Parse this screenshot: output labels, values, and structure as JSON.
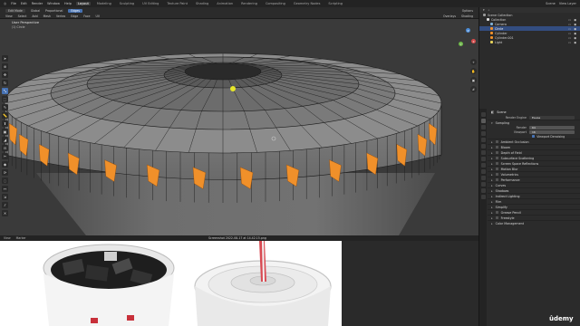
{
  "menubar": {
    "menus": [
      "File",
      "Edit",
      "Render",
      "Window",
      "Help"
    ],
    "workspaces": [
      "Layout",
      "Modeling",
      "Sculpting",
      "UV Editing",
      "Texture Paint",
      "Shading",
      "Animation",
      "Rendering",
      "Compositing",
      "Geometry Nodes",
      "Scripting"
    ],
    "active_workspace": "Layout",
    "right": [
      "Scene",
      "View Layer"
    ]
  },
  "toolheader": {
    "mode": "Edit Mode",
    "items": [
      "Global",
      "Proportional",
      "Options"
    ],
    "select_mode": "Edges"
  },
  "viewheader": {
    "items": [
      "View",
      "Select",
      "Add",
      "Mesh",
      "Vertex",
      "Edge",
      "Face",
      "UV"
    ],
    "shading": "Shading",
    "overlays": "Overlays"
  },
  "viewport": {
    "title": "User Perspective",
    "subtitle": "(1) Circle"
  },
  "toolbar": {
    "tools": [
      "select-tool",
      "cursor-tool",
      "move-tool",
      "rotate-tool",
      "scale-tool",
      "transform-tool",
      "annotate-tool",
      "measure-tool",
      "extrude-tool",
      "inset-tool",
      "bevel-tool",
      "loopcut-tool",
      "knife-tool",
      "polybuild-tool",
      "spin-tool",
      "smooth-tool",
      "edgeslide-tool",
      "shrink-tool",
      "shear-tool",
      "rip-tool"
    ],
    "active_index": 4
  },
  "gizmo": {
    "x": "X",
    "y": "Y",
    "z": "Z"
  },
  "statusbar": {
    "left": [
      "View",
      "Marker"
    ],
    "center": "Screenshot 2022-08-17 at 14.42.15.png"
  },
  "outliner": {
    "header": "Scene Collection",
    "items": [
      {
        "label": "Scene Collection",
        "selected": false
      },
      {
        "label": "Collection",
        "selected": false
      },
      {
        "label": "Camera",
        "selected": false
      },
      {
        "label": "Circle",
        "selected": true
      },
      {
        "label": "Cylinder",
        "selected": false
      },
      {
        "label": "Cylinder.001",
        "selected": false
      },
      {
        "label": "Light",
        "selected": false
      }
    ]
  },
  "properties": {
    "title": "Scene",
    "render_engine_label": "Render Engine",
    "render_engine": "Eevee",
    "sampling": "Sampling",
    "render_label": "Render",
    "render_value": "64",
    "viewport_label": "Viewport",
    "viewport_value": "16",
    "denoising": "Viewport Denoising",
    "sections": [
      "Ambient Occlusion",
      "Bloom",
      "Depth of Field",
      "Subsurface Scattering",
      "Screen Space Reflections",
      "Motion Blur",
      "Volumetrics",
      "Performance",
      "Curves",
      "Shadows",
      "Indirect Lighting",
      "Film",
      "Simplify",
      "Grease Pencil",
      "Freestyle",
      "Color Management"
    ]
  },
  "badge": {
    "brand": "ûdemy"
  },
  "colors": {
    "viewport_bg": "#3a3a3a",
    "selected_face": "#f0902a",
    "active_blue": "#4772b3",
    "vertex_active": "#e6e62a"
  }
}
